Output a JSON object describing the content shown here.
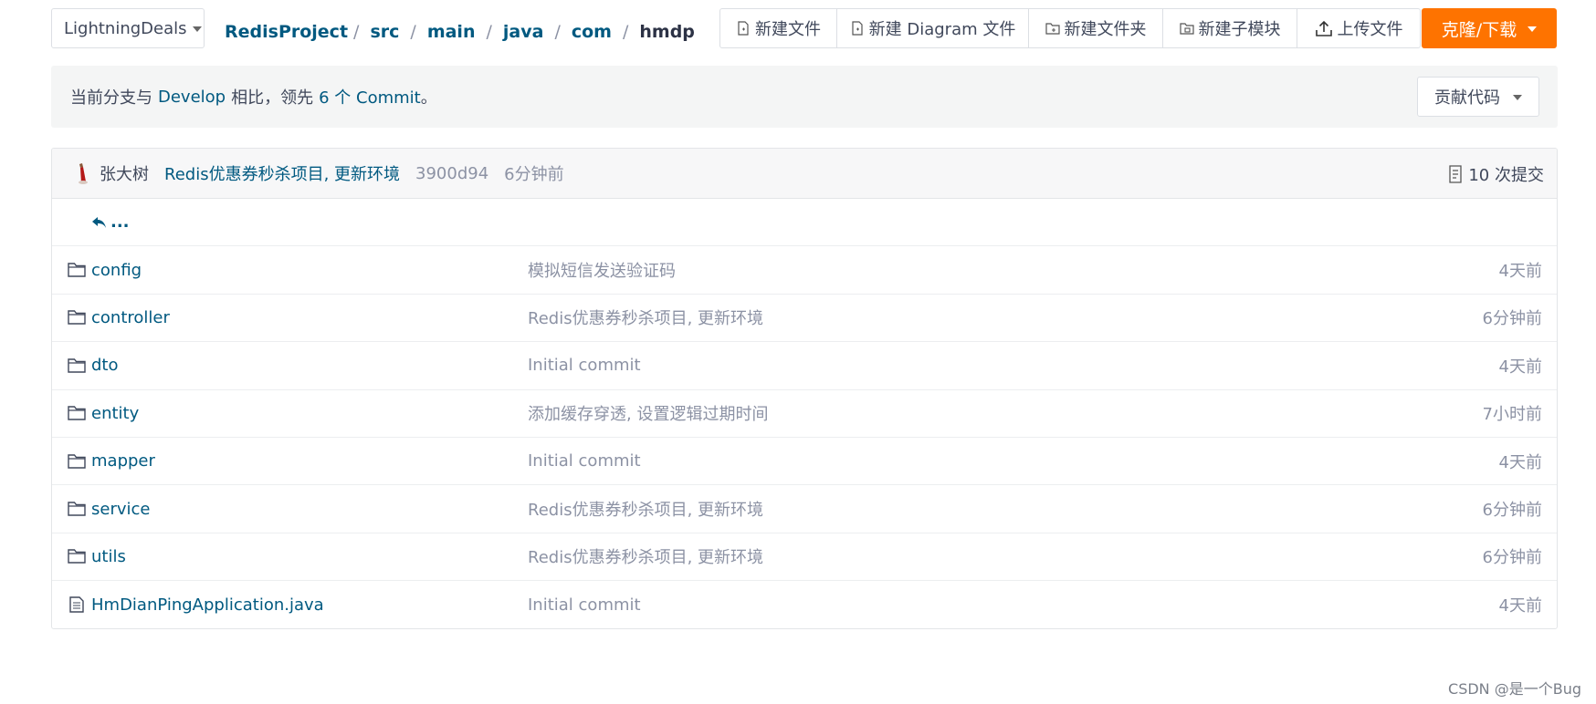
{
  "branch": {
    "name": "LightningDeals"
  },
  "breadcrumb": {
    "items": [
      "RedisProject",
      "src",
      "main",
      "java",
      "com",
      "hmdp"
    ]
  },
  "toolbar": {
    "new_file": "新建文件",
    "new_diagram": "新建 Diagram 文件",
    "new_folder": "新建文件夹",
    "new_submodule": "新建子模块",
    "upload_file": "上传文件",
    "clone_download": "克隆/下载"
  },
  "banner": {
    "prefix": "当前分支与",
    "branch": "Develop",
    "middle": "相比，领先",
    "count_text": "6 个 Commit",
    "suffix": "。",
    "contribute": "贡献代码"
  },
  "last_commit": {
    "author": "张大树",
    "message": "Redis优惠券秒杀项目, 更新环境",
    "hash": "3900d94",
    "time": "6分钟前",
    "commit_count": "10 次提交"
  },
  "back_link": "...",
  "files": [
    {
      "type": "folder",
      "name": "config",
      "message": "模拟短信发送验证码",
      "time": "4天前"
    },
    {
      "type": "folder",
      "name": "controller",
      "message": "Redis优惠券秒杀项目, 更新环境",
      "time": "6分钟前"
    },
    {
      "type": "folder",
      "name": "dto",
      "message": "Initial commit",
      "time": "4天前"
    },
    {
      "type": "folder",
      "name": "entity",
      "message": "添加缓存穿透, 设置逻辑过期时间",
      "time": "7小时前"
    },
    {
      "type": "folder",
      "name": "mapper",
      "message": "Initial commit",
      "time": "4天前"
    },
    {
      "type": "folder",
      "name": "service",
      "message": "Redis优惠券秒杀项目, 更新环境",
      "time": "6分钟前"
    },
    {
      "type": "folder",
      "name": "utils",
      "message": "Redis优惠券秒杀项目, 更新环境",
      "time": "6分钟前"
    },
    {
      "type": "file",
      "name": "HmDianPingApplication.java",
      "message": "Initial commit",
      "time": "4天前"
    }
  ],
  "watermark": "CSDN @是一个Bug",
  "colors": {
    "accent": "#fe7300",
    "link": "#005980",
    "muted": "#8c92a4"
  }
}
